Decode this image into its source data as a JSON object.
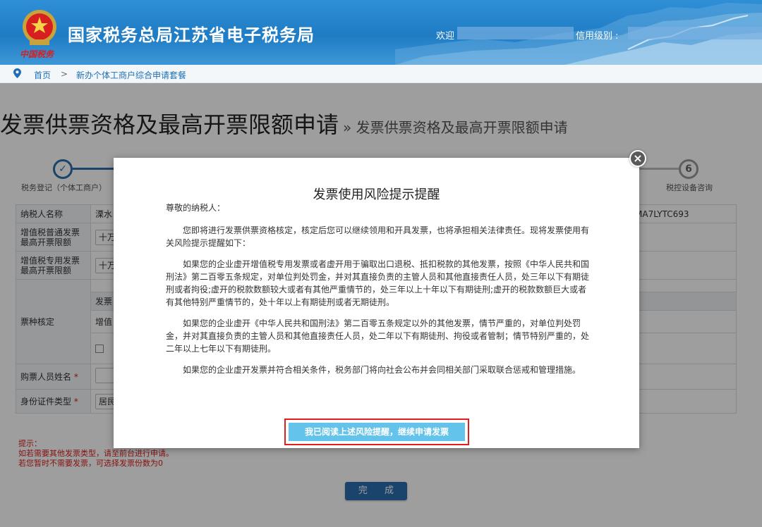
{
  "header": {
    "title": "国家税务总局江苏省电子税务局",
    "emblem_text": "中国税务",
    "welcome": "欢迎",
    "credit_label": "信用级别 :"
  },
  "breadcrumb": {
    "home": "首页",
    "separator": ">",
    "current": "新办个体工商户综合申请套餐"
  },
  "page": {
    "title": "发票供票资格及最高开票限额申请",
    "subtitle": "» 发票供票资格及最高开票限额申请"
  },
  "steps": [
    {
      "num": "✓",
      "label": "税务登记（个体工商户）"
    },
    {
      "num": "6",
      "label": "税控设备咨询"
    }
  ],
  "form": {
    "taxpayer_name_label": "纳税人名称",
    "taxpayer_name_value": "溧水",
    "taxpayer_id_value": "MA7LYTC693",
    "vat_normal_label": "增值税普通发票最高开票限额",
    "vat_normal_value": "十万",
    "vat_special_label": "增值税专用发票最高开票限额",
    "vat_special_value": "十万",
    "invoice_type_label": "票种核定",
    "invoice_type_header": "发票",
    "invoice_type_row": "增值",
    "buyer_name_label": "购票人员姓名",
    "id_type_label": "身份证件类型",
    "id_type_value": "居民",
    "required_mark": "*"
  },
  "tips": {
    "title": "提示：",
    "line1": "如若需要其他发票类型，请至前台进行申请。",
    "line2": "若您暂时不需要发票，可选择发票份数为0"
  },
  "finish_button": "完 成",
  "modal": {
    "close": "×",
    "title": "发票使用风险提示提醒",
    "greeting": "尊敬的纳税人：",
    "p1": "您即将进行发票供票资格核定，核定后您可以继续领用和开具发票，也将承担相关法律责任。现将发票使用有关风险提示提醒如下：",
    "p2": "如果您的企业虚开增值税专用发票或者虚开用于骗取出口退税、抵扣税款的其他发票，按照《中华人民共和国刑法》第二百零五条规定，对单位判处罚金，并对其直接负责的主管人员和其他直接责任人员，处三年以下有期徒刑或者拘役;虚开的税款数额较大或者有其他严重情节的，处三年以上十年以下有期徒刑;虚开的税款数额巨大或者有其他特别严重情节的，处十年以上有期徒刑或者无期徒刑。",
    "p3": "如果您的企业虚开《中华人民共和国刑法》第二百零五条规定以外的其他发票，情节严重的，对单位判处罚金，并对其直接负责的主管人员和其他直接责任人员，处二年以下有期徒刑、拘役或者管制；情节特别严重的，处二年以上七年以下有期徒刑。",
    "p4": "如果您的企业虚开发票并符合相关条件，税务部门将向社会公布并会同相关部门采取联合惩戒和管理措施。",
    "confirm": "我已阅读上述风险提醒，继续申请发票"
  },
  "colors": {
    "header_blue": "#1f7cc4",
    "step_blue": "#2c6fa8",
    "confirm_button": "#63c3ea",
    "highlight_red": "#e21d1d",
    "tip_red": "#d81e1e"
  }
}
